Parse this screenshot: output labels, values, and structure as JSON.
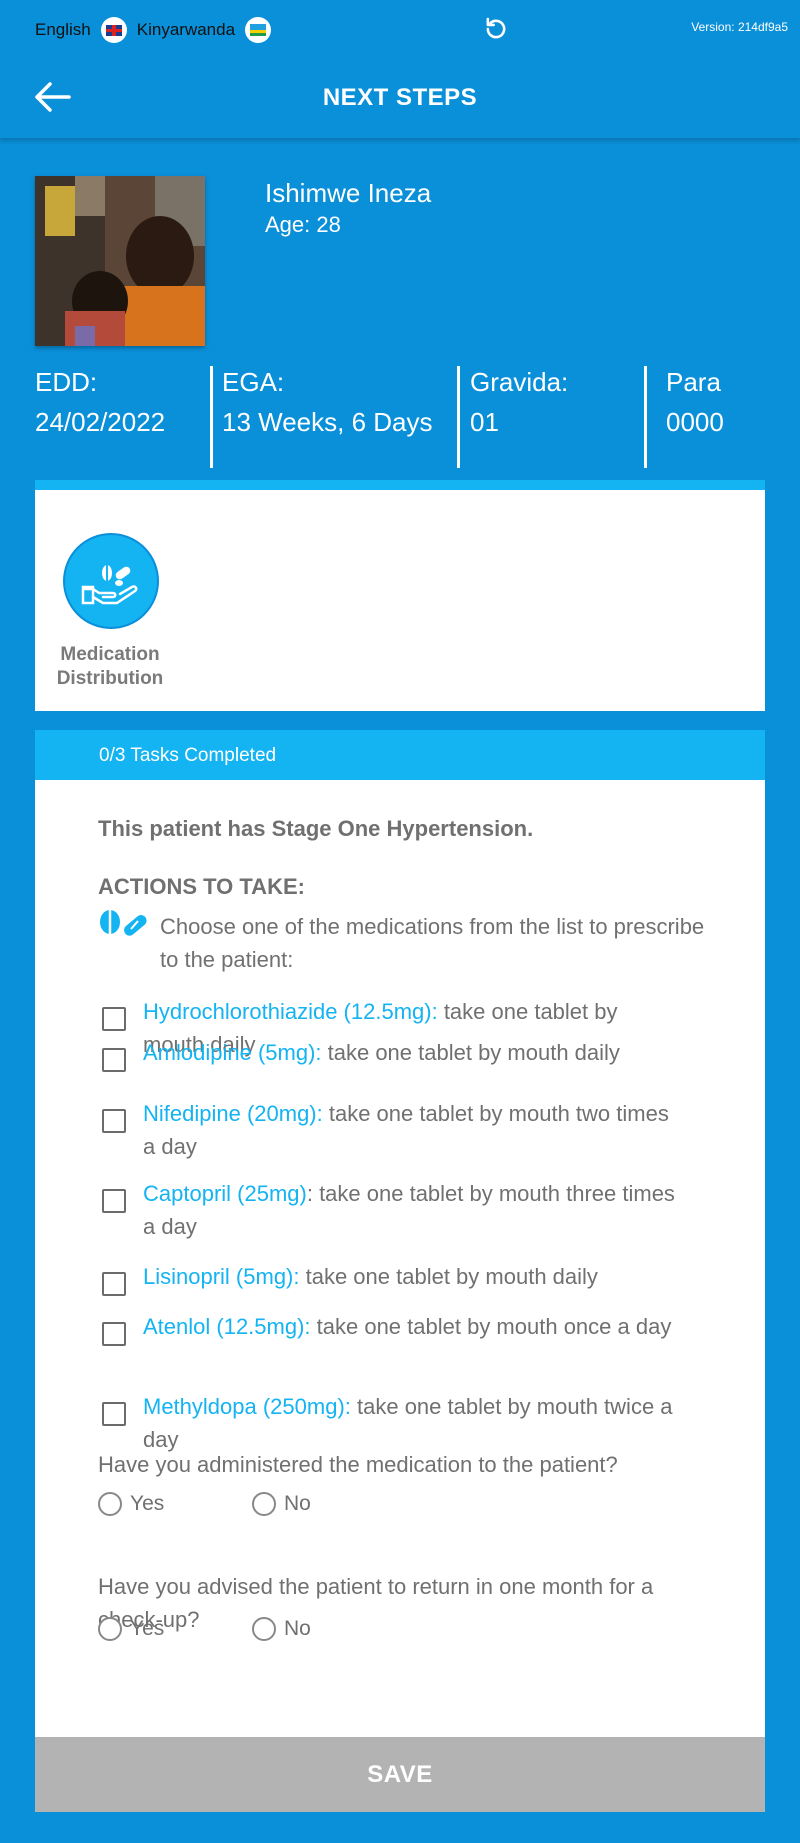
{
  "topbar": {
    "lang_english": "English",
    "lang_kinyarwanda": "Kinyarwanda",
    "version": "Version: 214df9a5",
    "title": "NEXT STEPS"
  },
  "patient": {
    "name": "Ishimwe Ineza",
    "age": "Age: 28",
    "stats": [
      {
        "label": "EDD:",
        "value": "24/02/2022"
      },
      {
        "label": "EGA:",
        "value": "13 Weeks, 6 Days"
      },
      {
        "label": "Gravida:",
        "value": "01"
      },
      {
        "label": "Para",
        "value": "0000"
      }
    ]
  },
  "services": {
    "medication_label": "Medication\nDistribution"
  },
  "tasks": {
    "progress": "0/3 Tasks Completed",
    "diagnosis": "This patient has Stage One Hypertension.",
    "actions_heading": "ACTIONS TO TAKE:",
    "instruction": "Choose one of the medications from the list to prescribe to the patient:",
    "medications": [
      {
        "name": "Hydrochlorothiazide (12.5mg):",
        "dose": " take one tablet by mouth daily"
      },
      {
        "name": "Amlodipine (5mg):",
        "dose": " take one tablet by mouth daily"
      },
      {
        "name": "Nifedipine (20mg):",
        "dose": " take one tablet by mouth two times a day"
      },
      {
        "name": "Captopril (25mg)",
        "dose": ": take one tablet by mouth three times a day"
      },
      {
        "name": "Lisinopril (5mg):",
        "dose": " take one tablet by mouth daily"
      },
      {
        "name": "Atenlol (12.5mg):",
        "dose": " take one tablet by mouth once a day"
      },
      {
        "name": "Methyldopa (250mg):",
        "dose": " take one tablet by mouth twice a day"
      }
    ],
    "q1": "Have you administered the medication to the patient?",
    "q2": "Have you advised the patient to return in one month for a check-up?",
    "yes": "Yes",
    "no": "No"
  },
  "save_label": "SAVE",
  "colors": {
    "background": "#0a8fd9",
    "accent": "#14b3f2",
    "text_gray": "#707070",
    "save_disabled": "#b3b3b3"
  }
}
